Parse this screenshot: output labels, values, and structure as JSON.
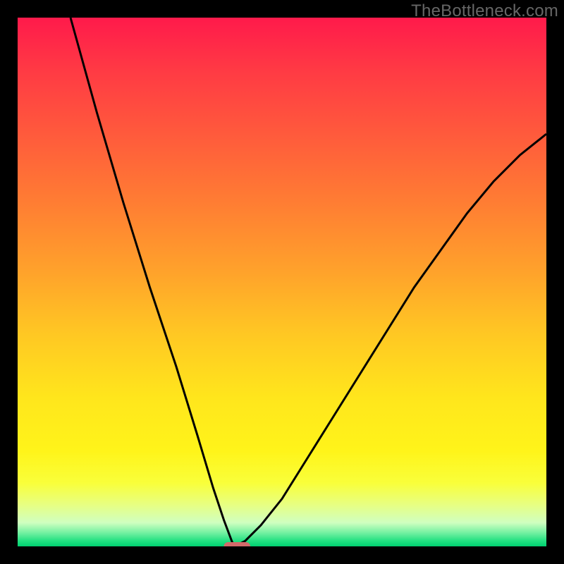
{
  "watermark": "TheBottleneck.com",
  "chart_data": {
    "type": "line",
    "title": "",
    "xlabel": "",
    "ylabel": "",
    "xlim": [
      0,
      100
    ],
    "ylim": [
      0,
      100
    ],
    "optimum_x": 41,
    "curve_left": [
      {
        "x": 10,
        "y": 100
      },
      {
        "x": 15,
        "y": 82
      },
      {
        "x": 20,
        "y": 65
      },
      {
        "x": 25,
        "y": 49
      },
      {
        "x": 30,
        "y": 34
      },
      {
        "x": 34,
        "y": 21
      },
      {
        "x": 37,
        "y": 11
      },
      {
        "x": 39,
        "y": 5
      },
      {
        "x": 40.5,
        "y": 1
      },
      {
        "x": 41,
        "y": 0
      }
    ],
    "curve_right": [
      {
        "x": 41,
        "y": 0
      },
      {
        "x": 43,
        "y": 1
      },
      {
        "x": 46,
        "y": 4
      },
      {
        "x": 50,
        "y": 9
      },
      {
        "x": 55,
        "y": 17
      },
      {
        "x": 60,
        "y": 25
      },
      {
        "x": 65,
        "y": 33
      },
      {
        "x": 70,
        "y": 41
      },
      {
        "x": 75,
        "y": 49
      },
      {
        "x": 80,
        "y": 56
      },
      {
        "x": 85,
        "y": 63
      },
      {
        "x": 90,
        "y": 69
      },
      {
        "x": 95,
        "y": 74
      },
      {
        "x": 100,
        "y": 78
      }
    ],
    "marker": {
      "x_start": 39,
      "x_end": 44,
      "y": 0,
      "color": "#d26a6a"
    },
    "gradient_stops": [
      {
        "pos": 0.0,
        "color": "#ff1a4b"
      },
      {
        "pos": 0.1,
        "color": "#ff3a44"
      },
      {
        "pos": 0.22,
        "color": "#ff5a3c"
      },
      {
        "pos": 0.35,
        "color": "#ff7d33"
      },
      {
        "pos": 0.48,
        "color": "#ffa22b"
      },
      {
        "pos": 0.6,
        "color": "#ffc823"
      },
      {
        "pos": 0.72,
        "color": "#ffe61c"
      },
      {
        "pos": 0.82,
        "color": "#fff41a"
      },
      {
        "pos": 0.88,
        "color": "#f9ff3a"
      },
      {
        "pos": 0.92,
        "color": "#e8ff80"
      },
      {
        "pos": 0.955,
        "color": "#d0ffc0"
      },
      {
        "pos": 0.975,
        "color": "#70f0a0"
      },
      {
        "pos": 0.99,
        "color": "#20e080"
      },
      {
        "pos": 1.0,
        "color": "#00d070"
      }
    ]
  }
}
